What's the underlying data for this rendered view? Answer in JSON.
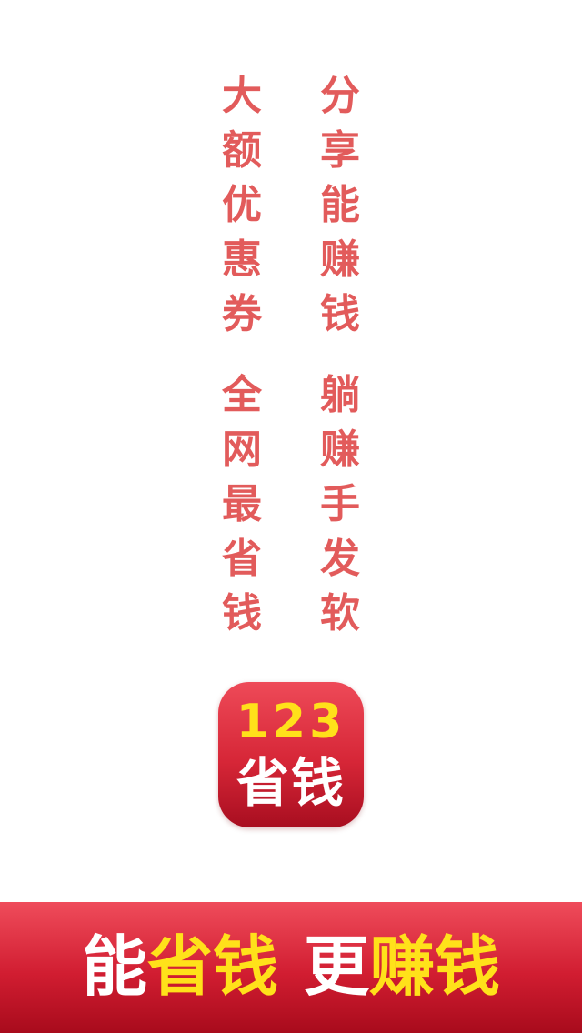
{
  "slogans": {
    "left_top": [
      "大",
      "额",
      "优",
      "惠",
      "券"
    ],
    "right_top": [
      "分",
      "享",
      "能",
      "赚",
      "钱"
    ],
    "left_bottom": [
      "全",
      "网",
      "最",
      "省",
      "钱"
    ],
    "right_bottom": [
      "躺",
      "赚",
      "手",
      "发",
      "软"
    ]
  },
  "app_icon": {
    "number": "123",
    "name": "省钱"
  },
  "banner": {
    "part1": "能",
    "part2": "省钱",
    "part3": "更",
    "part4": "赚钱"
  },
  "colors": {
    "slogan_text": "#e25b5b",
    "brand_red": "#d62637",
    "highlight_yellow": "#ffe11a",
    "banner_white": "#ffffff"
  }
}
